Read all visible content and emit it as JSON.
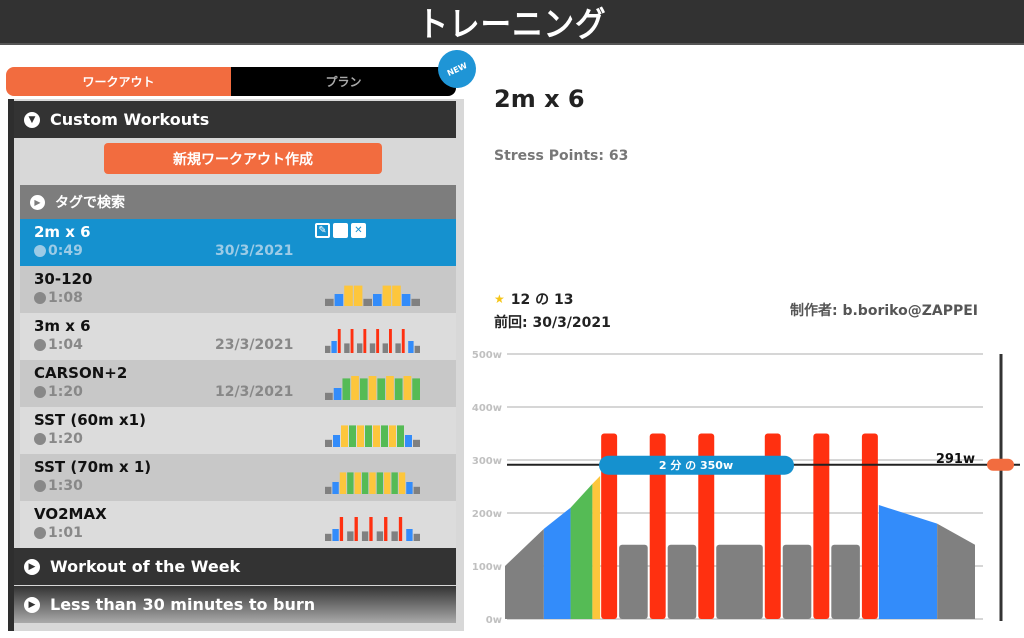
{
  "header": {
    "title": "トレーニング"
  },
  "tabs": [
    {
      "label": "ワークアウト",
      "active": true
    },
    {
      "label": "プラン",
      "active": false
    }
  ],
  "new_badge": "NEW",
  "sections": {
    "custom": "Custom Workouts",
    "workout_of_week": "Workout of the Week",
    "less_than_30": "Less than 30 minutes to burn"
  },
  "create_button": "新規ワークアウト作成",
  "tag_search": "タグで検索",
  "workouts": [
    {
      "name": "2m  x 6",
      "duration": "0:49",
      "date": "30/3/2021",
      "selected": true,
      "mini": []
    },
    {
      "name": "30-120",
      "duration": "1:08",
      "date": "",
      "mini": [
        [
          "g",
          30
        ],
        [
          "b",
          50
        ],
        [
          "y",
          85
        ],
        [
          "y",
          85
        ],
        [
          "g",
          30
        ],
        [
          "b",
          50
        ],
        [
          "y",
          85
        ],
        [
          "y",
          85
        ],
        [
          "b",
          50
        ],
        [
          "g",
          30
        ]
      ]
    },
    {
      "name": "3m x 6",
      "duration": "1:04",
      "date": "23/3/2021",
      "mini": [
        [
          "g",
          30
        ],
        [
          "b",
          50
        ],
        [
          "r",
          100
        ],
        [
          "g",
          40
        ],
        [
          "r",
          100
        ],
        [
          "g",
          40
        ],
        [
          "r",
          100
        ],
        [
          "g",
          40
        ],
        [
          "r",
          100
        ],
        [
          "g",
          40
        ],
        [
          "r",
          100
        ],
        [
          "g",
          40
        ],
        [
          "r",
          100
        ],
        [
          "b",
          50
        ],
        [
          "g",
          30
        ]
      ]
    },
    {
      "name": "CARSON+2",
      "duration": "1:20",
      "date": "12/3/2021",
      "mini": [
        [
          "g",
          30
        ],
        [
          "b",
          50
        ],
        [
          "gr",
          90
        ],
        [
          "y",
          100
        ],
        [
          "gr",
          90
        ],
        [
          "y",
          100
        ],
        [
          "gr",
          90
        ],
        [
          "y",
          100
        ],
        [
          "gr",
          90
        ],
        [
          "y",
          100
        ],
        [
          "gr",
          90
        ]
      ]
    },
    {
      "name": "SST (60m x1)",
      "duration": "1:20",
      "date": "",
      "mini": [
        [
          "g",
          30
        ],
        [
          "b",
          50
        ],
        [
          "y",
          90
        ],
        [
          "gr",
          90
        ],
        [
          "y",
          90
        ],
        [
          "gr",
          90
        ],
        [
          "y",
          90
        ],
        [
          "gr",
          90
        ],
        [
          "y",
          90
        ],
        [
          "gr",
          90
        ],
        [
          "b",
          50
        ],
        [
          "g",
          30
        ]
      ]
    },
    {
      "name": "SST (70m x 1)",
      "duration": "1:30",
      "date": "",
      "mini": [
        [
          "g",
          30
        ],
        [
          "b",
          50
        ],
        [
          "y",
          90
        ],
        [
          "gr",
          90
        ],
        [
          "y",
          90
        ],
        [
          "gr",
          90
        ],
        [
          "y",
          90
        ],
        [
          "gr",
          90
        ],
        [
          "y",
          90
        ],
        [
          "gr",
          90
        ],
        [
          "y",
          90
        ],
        [
          "b",
          50
        ],
        [
          "g",
          30
        ]
      ]
    },
    {
      "name": "VO2MAX",
      "duration": "1:01",
      "date": "",
      "mini": [
        [
          "g",
          30
        ],
        [
          "b",
          50
        ],
        [
          "r",
          100
        ],
        [
          "g",
          40
        ],
        [
          "r",
          100
        ],
        [
          "g",
          40
        ],
        [
          "r",
          100
        ],
        [
          "g",
          40
        ],
        [
          "r",
          100
        ],
        [
          "g",
          40
        ],
        [
          "r",
          100
        ],
        [
          "b",
          50
        ],
        [
          "g",
          30
        ]
      ]
    }
  ],
  "detail": {
    "title": "2m  x 6",
    "stress_points": "Stress Points: 63",
    "rating": "12 の 13",
    "last_ridden": "前回: 30/3/2021",
    "author": "制作者: b.boriko@ZAPPEI"
  },
  "colors": {
    "accent": "#f26c3f",
    "selected": "#1591cf",
    "gray": "#808080",
    "blue": "#338cfa",
    "green": "#55bb55",
    "yellow": "#fdc63c",
    "red": "#ff3010"
  },
  "chart_data": {
    "type": "bar",
    "title": "",
    "ylabel": "",
    "ylim": [
      0,
      500
    ],
    "yticks": [
      "0w",
      "100w",
      "200w",
      "300w",
      "400w",
      "500w"
    ],
    "ftp_label": "291w",
    "ftp_value": 291,
    "interval_tooltip": "2 分 の 350w",
    "segments": [
      {
        "kind": "ramp",
        "color": "gray",
        "from_w": 100,
        "to_w": 170,
        "duration": 8
      },
      {
        "kind": "ramp",
        "color": "blue",
        "from_w": 170,
        "to_w": 210,
        "duration": 5.5
      },
      {
        "kind": "ramp",
        "color": "green",
        "from_w": 210,
        "to_w": 255,
        "duration": 4.5
      },
      {
        "kind": "ramp",
        "color": "yellow",
        "from_w": 255,
        "to_w": 270,
        "duration": 1.6
      },
      {
        "kind": "steady",
        "color": "red",
        "watts": 350,
        "duration": 3.7
      },
      {
        "kind": "steady",
        "color": "gray",
        "watts": 140,
        "duration": 6.3
      },
      {
        "kind": "steady",
        "color": "red",
        "watts": 350,
        "duration": 3.7
      },
      {
        "kind": "steady",
        "color": "gray",
        "watts": 140,
        "duration": 6.3
      },
      {
        "kind": "steady",
        "color": "red",
        "watts": 350,
        "duration": 3.7
      },
      {
        "kind": "steady",
        "color": "gray",
        "watts": 140,
        "duration": 10
      },
      {
        "kind": "steady",
        "color": "red",
        "watts": 350,
        "duration": 3.7
      },
      {
        "kind": "steady",
        "color": "gray",
        "watts": 140,
        "duration": 6.3
      },
      {
        "kind": "steady",
        "color": "red",
        "watts": 350,
        "duration": 3.7
      },
      {
        "kind": "steady",
        "color": "gray",
        "watts": 140,
        "duration": 6.3
      },
      {
        "kind": "steady",
        "color": "red",
        "watts": 350,
        "duration": 3.7
      },
      {
        "kind": "ramp",
        "color": "blue",
        "from_w": 215,
        "to_w": 180,
        "duration": 12
      },
      {
        "kind": "ramp",
        "color": "gray",
        "from_w": 180,
        "to_w": 140,
        "duration": 7.8
      }
    ]
  }
}
